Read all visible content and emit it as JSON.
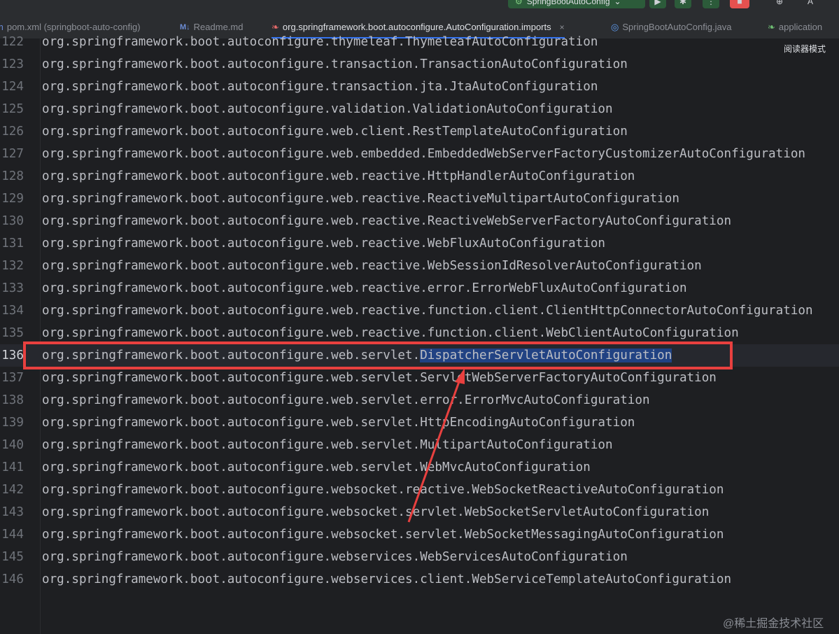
{
  "toolbar": {
    "run_config_label": "SpringBootAutoConfig"
  },
  "tabs": [
    {
      "label": "pom.xml (springboot-auto-config)",
      "icon": "maven-icon"
    },
    {
      "label": "Readme.md",
      "icon": "markdown-icon",
      "icon_text": "M↓"
    },
    {
      "label": "org.springframework.boot.autoconfigure.AutoConfiguration.imports",
      "icon": "spring-leaf-icon",
      "active": true
    },
    {
      "label": "SpringBootAutoConfig.java",
      "icon": "java-class-icon"
    },
    {
      "label": "application",
      "icon": "spring-leaf-icon"
    }
  ],
  "reader_mode_label": "阅读器模式",
  "editor": {
    "current_line": "136",
    "selected_text": "DispatcherServletAutoConfiguration",
    "lines": [
      {
        "n": "122",
        "text": "org.springframework.boot.autoconfigure.thymeleaf.ThymeleafAutoConfiguration"
      },
      {
        "n": "123",
        "text": "org.springframework.boot.autoconfigure.transaction.TransactionAutoConfiguration"
      },
      {
        "n": "124",
        "text": "org.springframework.boot.autoconfigure.transaction.jta.JtaAutoConfiguration"
      },
      {
        "n": "125",
        "text": "org.springframework.boot.autoconfigure.validation.ValidationAutoConfiguration"
      },
      {
        "n": "126",
        "text": "org.springframework.boot.autoconfigure.web.client.RestTemplateAutoConfiguration"
      },
      {
        "n": "127",
        "text": "org.springframework.boot.autoconfigure.web.embedded.EmbeddedWebServerFactoryCustomizerAutoConfiguration"
      },
      {
        "n": "128",
        "text": "org.springframework.boot.autoconfigure.web.reactive.HttpHandlerAutoConfiguration"
      },
      {
        "n": "129",
        "text": "org.springframework.boot.autoconfigure.web.reactive.ReactiveMultipartAutoConfiguration"
      },
      {
        "n": "130",
        "text": "org.springframework.boot.autoconfigure.web.reactive.ReactiveWebServerFactoryAutoConfiguration"
      },
      {
        "n": "131",
        "text": "org.springframework.boot.autoconfigure.web.reactive.WebFluxAutoConfiguration"
      },
      {
        "n": "132",
        "text": "org.springframework.boot.autoconfigure.web.reactive.WebSessionIdResolverAutoConfiguration"
      },
      {
        "n": "133",
        "text": "org.springframework.boot.autoconfigure.web.reactive.error.ErrorWebFluxAutoConfiguration"
      },
      {
        "n": "134",
        "text": "org.springframework.boot.autoconfigure.web.reactive.function.client.ClientHttpConnectorAutoConfiguration"
      },
      {
        "n": "135",
        "text": "org.springframework.boot.autoconfigure.web.reactive.function.client.WebClientAutoConfiguration"
      },
      {
        "n": "136",
        "text_prefix": "org.springframework.boot.autoconfigure.web.servlet.",
        "text_selected": "DispatcherServletAutoConfiguration"
      },
      {
        "n": "137",
        "text": "org.springframework.boot.autoconfigure.web.servlet.ServletWebServerFactoryAutoConfiguration"
      },
      {
        "n": "138",
        "text": "org.springframework.boot.autoconfigure.web.servlet.error.ErrorMvcAutoConfiguration"
      },
      {
        "n": "139",
        "text": "org.springframework.boot.autoconfigure.web.servlet.HttpEncodingAutoConfiguration"
      },
      {
        "n": "140",
        "text": "org.springframework.boot.autoconfigure.web.servlet.MultipartAutoConfiguration"
      },
      {
        "n": "141",
        "text": "org.springframework.boot.autoconfigure.web.servlet.WebMvcAutoConfiguration"
      },
      {
        "n": "142",
        "text": "org.springframework.boot.autoconfigure.websocket.reactive.WebSocketReactiveAutoConfiguration"
      },
      {
        "n": "143",
        "text": "org.springframework.boot.autoconfigure.websocket.servlet.WebSocketServletAutoConfiguration"
      },
      {
        "n": "144",
        "text": "org.springframework.boot.autoconfigure.websocket.servlet.WebSocketMessagingAutoConfiguration"
      },
      {
        "n": "145",
        "text": "org.springframework.boot.autoconfigure.webservices.WebServicesAutoConfiguration"
      },
      {
        "n": "146",
        "text": "org.springframework.boot.autoconfigure.webservices.client.WebServiceTemplateAutoConfiguration"
      }
    ]
  },
  "annotation_colors": {
    "highlight_box": "#e8403f",
    "arrow": "#e8403f"
  },
  "watermark": "@稀土掘金技术社区"
}
